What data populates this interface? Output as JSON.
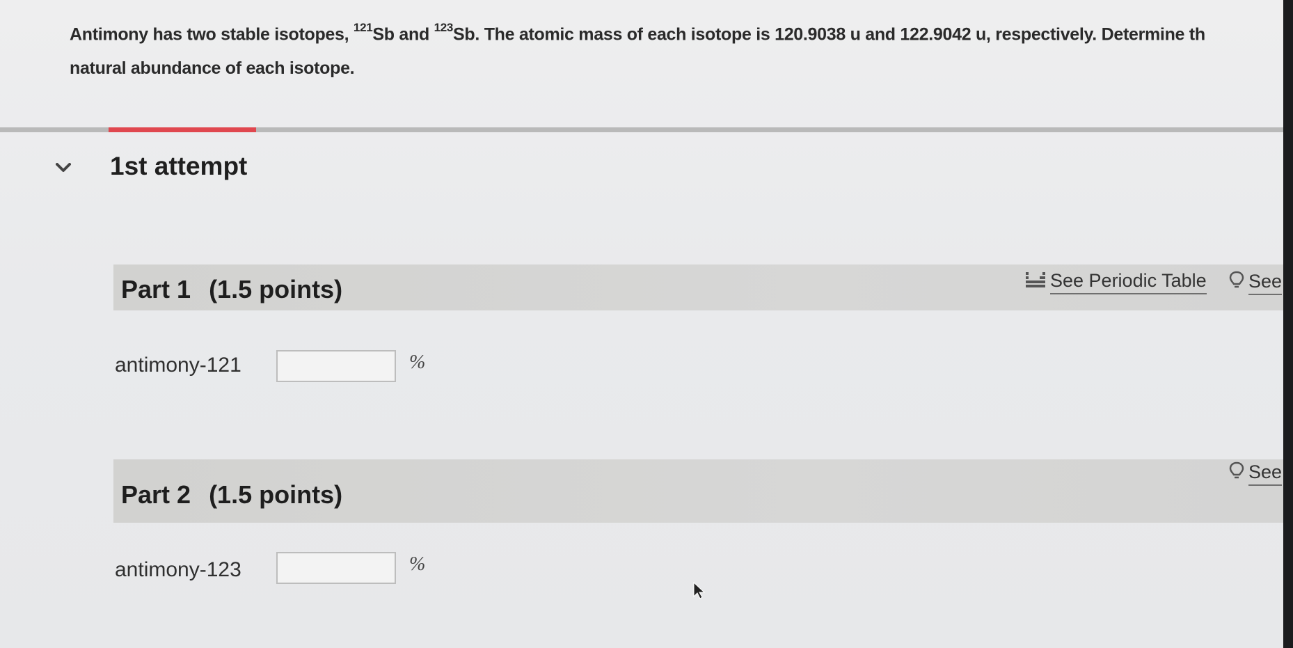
{
  "question": {
    "intro": "Antimony has two stable isotopes, ",
    "iso1_mass_number": "121",
    "iso1_symbol": "Sb and ",
    "iso2_mass_number": "123",
    "iso2_symbol": "Sb.",
    "rest_line1": " The atomic mass of each isotope is 120.9038 u and 122.9042 u, respectively. Determine th",
    "line2": "natural abundance of each isotope."
  },
  "attempt": {
    "title": "1st attempt"
  },
  "tools": {
    "periodic_table": "See Periodic Table",
    "hint": "See"
  },
  "parts": [
    {
      "label": "Part 1",
      "points": "(1.5 points)",
      "field_label": "antimony-121",
      "value": "",
      "unit": "%"
    },
    {
      "label": "Part 2",
      "points": "(1.5 points)",
      "field_label": "antimony-123",
      "value": "",
      "unit": "%"
    }
  ],
  "colors": {
    "progress": "#e0474f",
    "band": "#d4d4d3"
  },
  "icons": [
    "chevron-down-icon",
    "periodic-table-icon",
    "lightbulb-icon",
    "cursor-icon"
  ]
}
